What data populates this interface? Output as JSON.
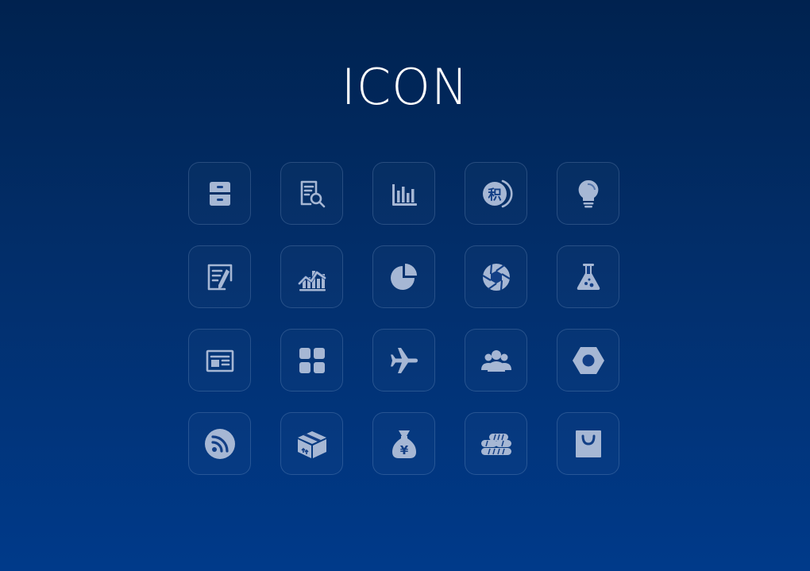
{
  "title": "ICON",
  "icons": [
    {
      "name": "cabinet-icon",
      "glyph": ""
    },
    {
      "name": "document-search-icon",
      "glyph": ""
    },
    {
      "name": "bar-chart-icon",
      "glyph": ""
    },
    {
      "name": "points-icon",
      "glyph": "积"
    },
    {
      "name": "lightbulb-icon",
      "glyph": ""
    },
    {
      "name": "edit-document-icon",
      "glyph": ""
    },
    {
      "name": "trend-chart-icon",
      "glyph": ""
    },
    {
      "name": "pie-chart-icon",
      "glyph": ""
    },
    {
      "name": "aperture-icon",
      "glyph": ""
    },
    {
      "name": "flask-icon",
      "glyph": ""
    },
    {
      "name": "newspaper-icon",
      "glyph": ""
    },
    {
      "name": "grid-apps-icon",
      "glyph": ""
    },
    {
      "name": "airplane-icon",
      "glyph": ""
    },
    {
      "name": "group-users-icon",
      "glyph": ""
    },
    {
      "name": "hex-nut-icon",
      "glyph": ""
    },
    {
      "name": "rss-feed-icon",
      "glyph": ""
    },
    {
      "name": "package-box-icon",
      "glyph": ""
    },
    {
      "name": "money-bag-icon",
      "glyph": "¥"
    },
    {
      "name": "steel-pipes-icon",
      "glyph": ""
    },
    {
      "name": "shopping-bag-icon",
      "glyph": ""
    }
  ],
  "colors": {
    "background_top": "#00224f",
    "background_bottom": "#003a8a",
    "icon": "#a6b7d4",
    "title": "#ffffff"
  }
}
